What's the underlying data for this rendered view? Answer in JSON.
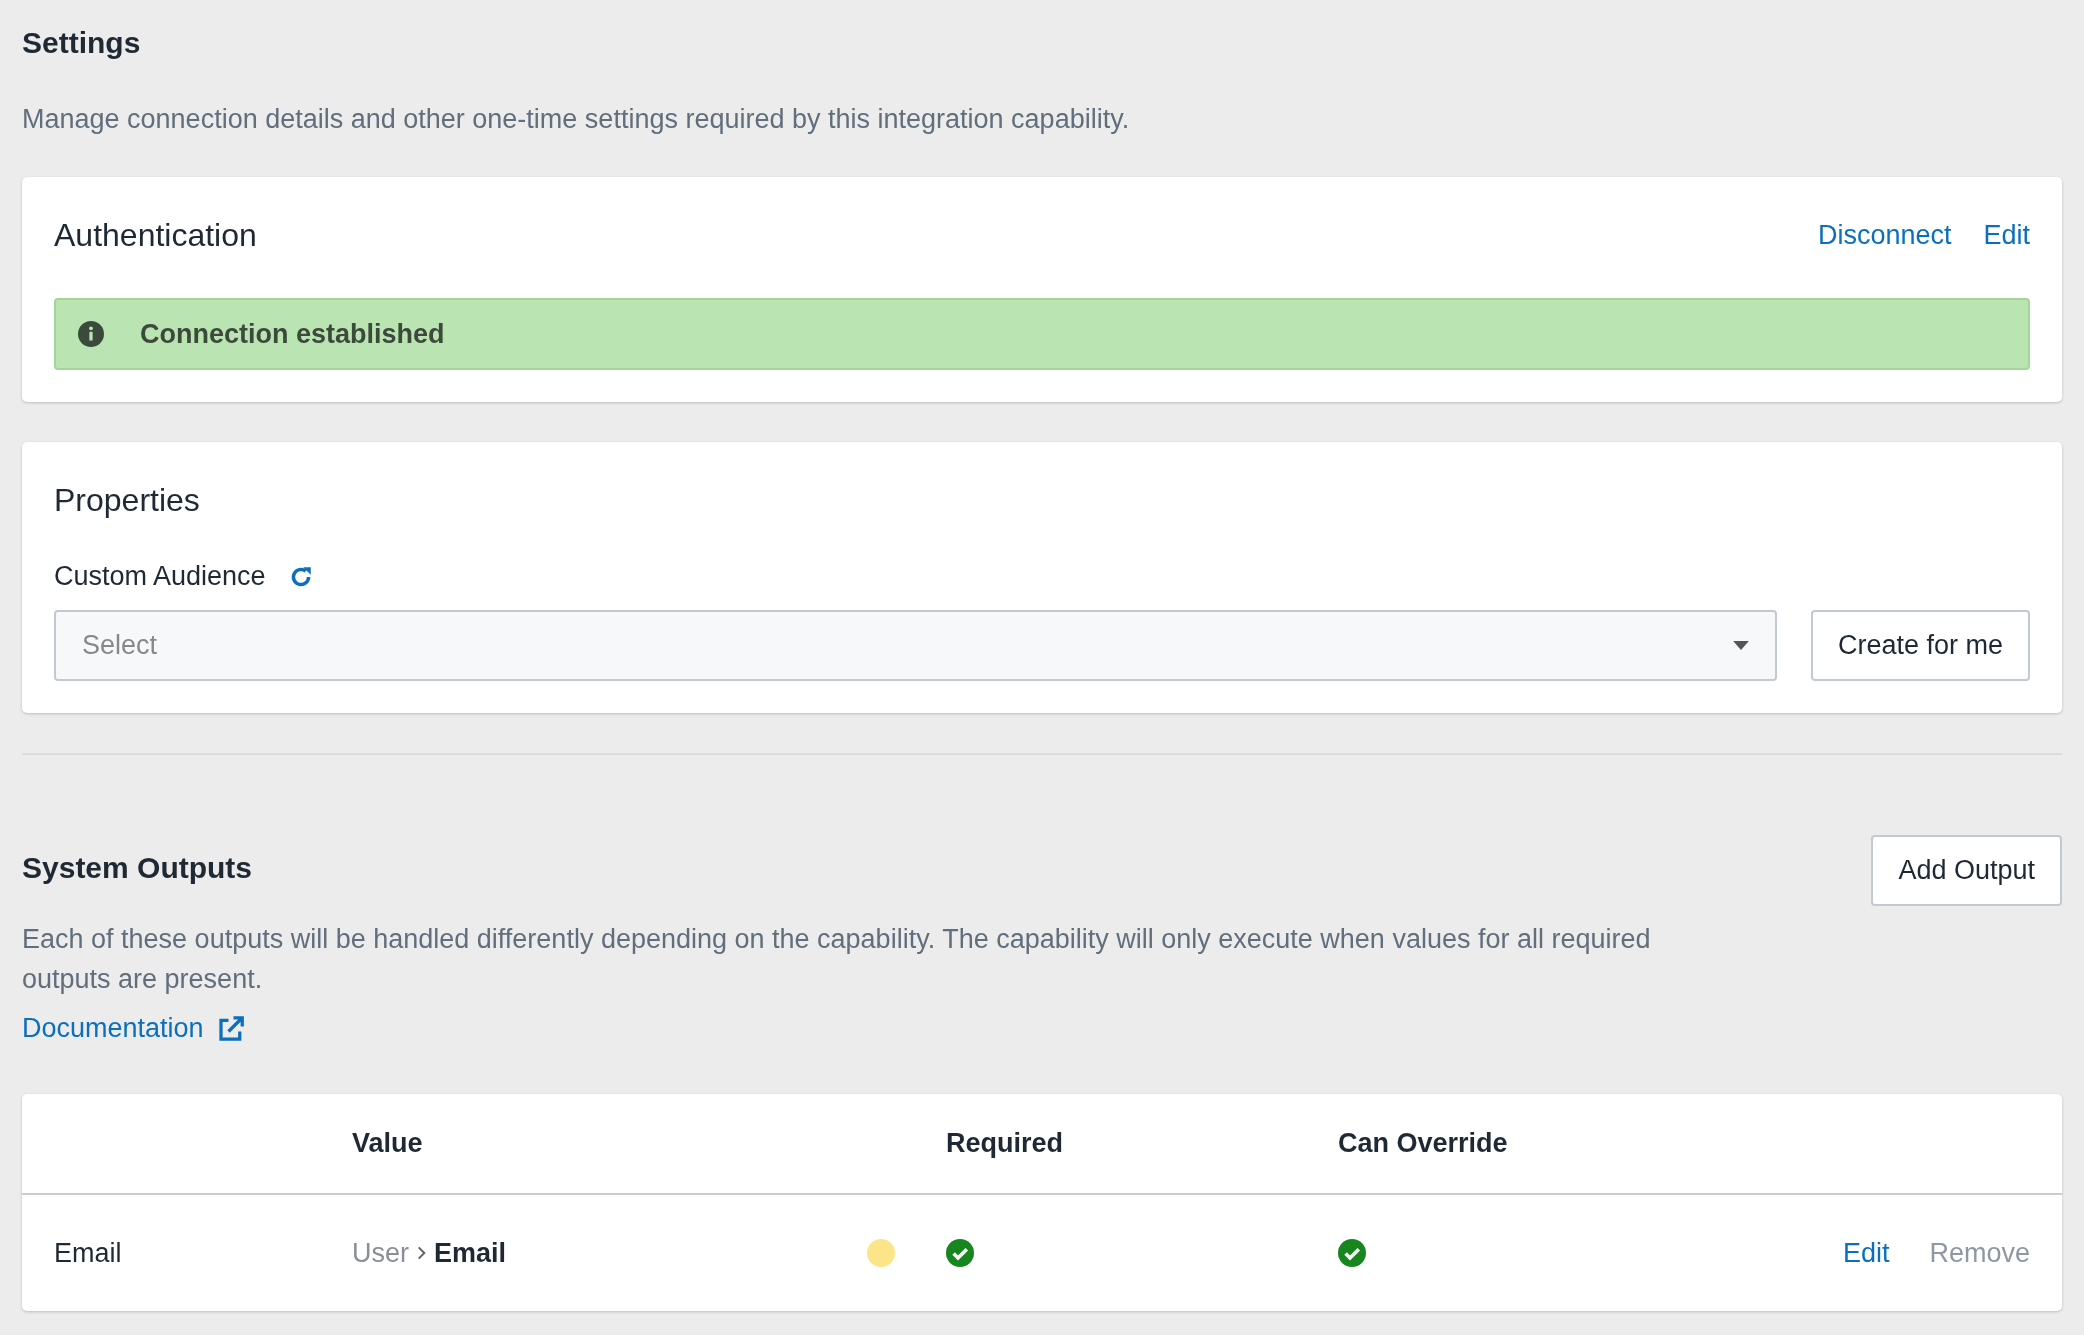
{
  "page": {
    "title": "Settings",
    "description": "Manage connection details and other one-time settings required by this integration capability."
  },
  "authentication": {
    "title": "Authentication",
    "actions": [
      "Disconnect",
      "Edit"
    ],
    "alert": {
      "kind": "success",
      "text": "Connection established"
    }
  },
  "properties": {
    "title": "Properties",
    "fields": [
      {
        "label": "Custom Audience",
        "placeholder": "Select",
        "button": "Create for me"
      }
    ]
  },
  "system_outputs": {
    "title": "System Outputs",
    "add_button": "Add Output",
    "description": "Each of these outputs will be handled differently depending on the capability. The capability will only execute when values for all required outputs are present.",
    "link": "Documentation",
    "table": {
      "columns": [
        "Value",
        "Required",
        "Can Override"
      ],
      "rows": [
        {
          "name": "Email",
          "path": [
            "User",
            "Email"
          ],
          "color": "#fce588",
          "required": true,
          "can_override": true,
          "actions": [
            {
              "label": "Edit",
              "disabled": false
            },
            {
              "label": "Remove",
              "disabled": true
            }
          ]
        }
      ]
    }
  }
}
